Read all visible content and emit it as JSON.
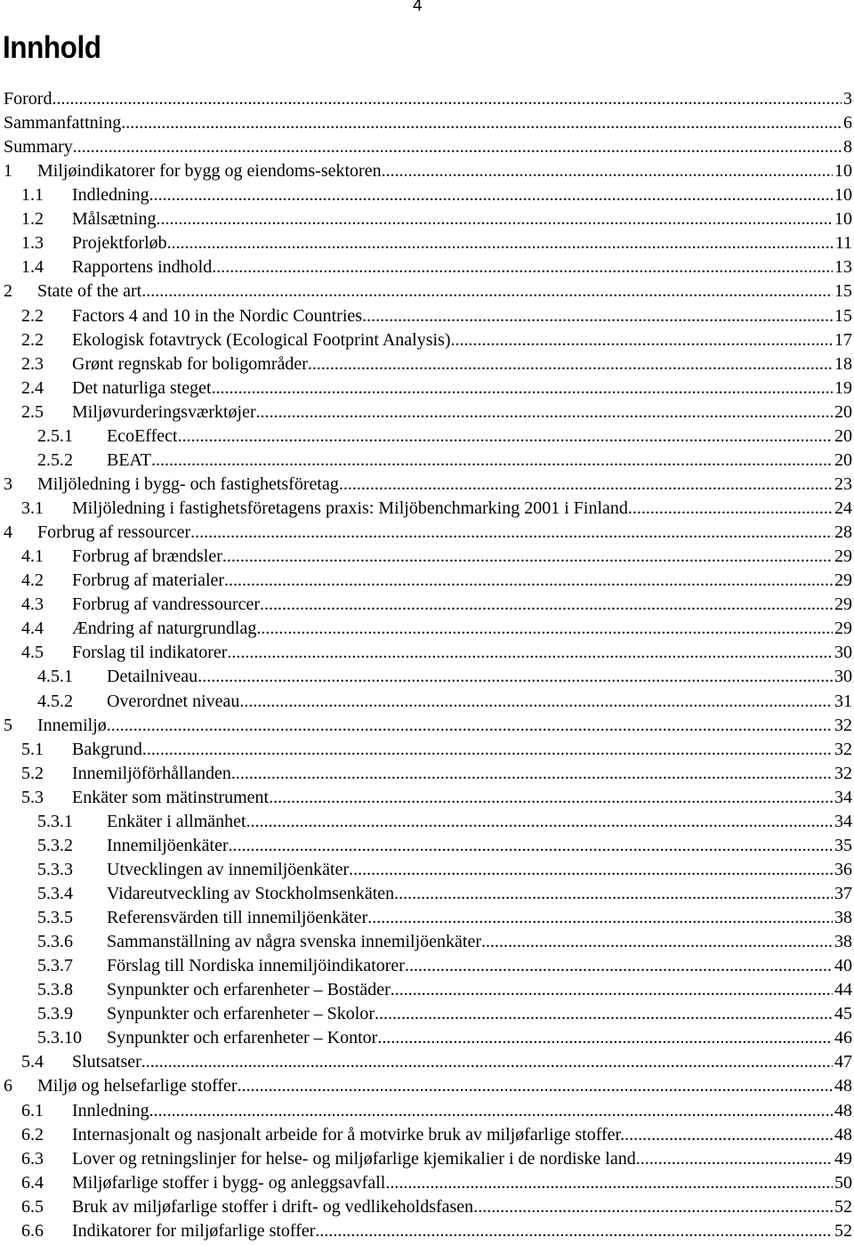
{
  "page_number": "4",
  "heading": "Innhold",
  "entries": [
    {
      "num": "",
      "title": "Forord",
      "page": "3",
      "level": 0
    },
    {
      "num": "",
      "title": "Sammanfattning",
      "page": "6",
      "level": 0
    },
    {
      "num": "",
      "title": "Summary",
      "page": "8",
      "level": 0
    },
    {
      "num": "1",
      "title": "Miljøindikatorer for bygg og eiendoms-sektoren",
      "page": "10",
      "level": 1
    },
    {
      "num": "1.1",
      "title": "Indledning",
      "page": "10",
      "level": 2
    },
    {
      "num": "1.2",
      "title": "Målsætning",
      "page": "10",
      "level": 2
    },
    {
      "num": "1.3",
      "title": "Projektforløb",
      "page": "11",
      "level": 2
    },
    {
      "num": "1.4",
      "title": "Rapportens indhold",
      "page": "13",
      "level": 2
    },
    {
      "num": "2",
      "title": "State of the art",
      "page": "15",
      "level": 1
    },
    {
      "num": "2.2",
      "title": "Factors 4 and 10 in the Nordic Countries",
      "page": "15",
      "level": 2
    },
    {
      "num": "2.2",
      "title": "Ekologisk fotavtryck (Ecological Footprint Analysis)",
      "page": "17",
      "level": 2
    },
    {
      "num": "2.3",
      "title": "Grønt regnskab for boligområder",
      "page": "18",
      "level": 2
    },
    {
      "num": "2.4",
      "title": "Det naturliga steget",
      "page": "19",
      "level": 2
    },
    {
      "num": "2.5",
      "title": "Miljøvurderingsværktøjer",
      "page": "20",
      "level": 2
    },
    {
      "num": "2.5.1",
      "title": "EcoEffect",
      "page": "20",
      "level": 3
    },
    {
      "num": "2.5.2",
      "title": "BEAT",
      "page": "20",
      "level": 3
    },
    {
      "num": "3",
      "title": "Miljöledning i bygg- och fastighetsföretag",
      "page": "23",
      "level": 1
    },
    {
      "num": "3.1",
      "title": "Miljöledning i fastighetsföretagens praxis: Miljöbenchmarking 2001 i Finland",
      "page": "24",
      "level": 2
    },
    {
      "num": "4",
      "title": "Forbrug af ressourcer",
      "page": "28",
      "level": 1
    },
    {
      "num": "4.1",
      "title": "Forbrug af brændsler",
      "page": "29",
      "level": 2
    },
    {
      "num": "4.2",
      "title": "Forbrug af materialer",
      "page": "29",
      "level": 2
    },
    {
      "num": "4.3",
      "title": "Forbrug af vandressourcer",
      "page": "29",
      "level": 2
    },
    {
      "num": "4.4",
      "title": "Ændring af naturgrundlag",
      "page": "29",
      "level": 2
    },
    {
      "num": "4.5",
      "title": "Forslag til indikatorer",
      "page": "30",
      "level": 2
    },
    {
      "num": "4.5.1",
      "title": "Detailniveau",
      "page": "30",
      "level": 3
    },
    {
      "num": "4.5.2",
      "title": "Overordnet niveau",
      "page": "31",
      "level": 3
    },
    {
      "num": "5",
      "title": "Innemiljø",
      "page": "32",
      "level": 1
    },
    {
      "num": "5.1",
      "title": "Bakgrund",
      "page": "32",
      "level": 2
    },
    {
      "num": "5.2",
      "title": "Innemiljöförhållanden",
      "page": "32",
      "level": 2
    },
    {
      "num": "5.3",
      "title": "Enkäter som mätinstrument",
      "page": "34",
      "level": 2
    },
    {
      "num": "5.3.1",
      "title": "Enkäter i allmänhet",
      "page": "34",
      "level": 3
    },
    {
      "num": "5.3.2",
      "title": "Innemiljöenkäter",
      "page": "35",
      "level": 3
    },
    {
      "num": "5.3.3",
      "title": "Utvecklingen av innemiljöenkäter",
      "page": "36",
      "level": 3
    },
    {
      "num": "5.3.4",
      "title": "Vidareutveckling av Stockholmsenkäten",
      "page": "37",
      "level": 3
    },
    {
      "num": "5.3.5",
      "title": "Referensvärden till innemiljöenkäter",
      "page": "38",
      "level": 3
    },
    {
      "num": "5.3.6",
      "title": "Sammanställning av några svenska innemiljöenkäter",
      "page": "38",
      "level": 3
    },
    {
      "num": "5.3.7",
      "title": "Förslag till Nordiska innemiljöindikatorer",
      "page": "40",
      "level": 3
    },
    {
      "num": "5.3.8",
      "title": "Synpunkter och erfarenheter – Bostäder",
      "page": "44",
      "level": 3
    },
    {
      "num": "5.3.9",
      "title": "Synpunkter och erfarenheter – Skolor",
      "page": "45",
      "level": 3
    },
    {
      "num": "5.3.10",
      "title": "Synpunkter och erfarenheter – Kontor",
      "page": "46",
      "level": 3
    },
    {
      "num": "5.4",
      "title": "Slutsatser",
      "page": "47",
      "level": 2
    },
    {
      "num": "6",
      "title": "Miljø og helsefarlige stoffer",
      "page": "48",
      "level": 1
    },
    {
      "num": "6.1",
      "title": "Innledning",
      "page": "48",
      "level": 2
    },
    {
      "num": "6.2",
      "title": "Internasjonalt og nasjonalt arbeide for å motvirke bruk av miljøfarlige stoffer.",
      "page": "48",
      "level": 2
    },
    {
      "num": "6.3",
      "title": "Lover og retningslinjer for helse- og miljøfarlige kjemikalier i de nordiske land",
      "page": "49",
      "level": 2
    },
    {
      "num": "6.4",
      "title": "Miljøfarlige stoffer i bygg- og anleggsavfall.",
      "page": "50",
      "level": 2
    },
    {
      "num": "6.5",
      "title": "Bruk av miljøfarlige stoffer i drift- og vedlikeholdsfasen.",
      "page": "52",
      "level": 2
    },
    {
      "num": "6.6",
      "title": "Indikatorer for miljøfarlige stoffer",
      "page": "52",
      "level": 2
    }
  ]
}
